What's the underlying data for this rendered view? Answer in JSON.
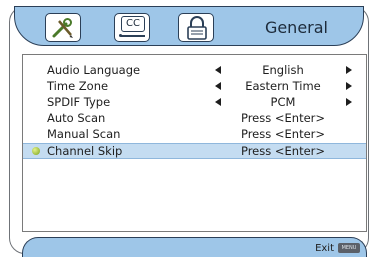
{
  "header": {
    "tabs": [
      {
        "icon": "wrench-pencil-icon"
      },
      {
        "label": "CC"
      },
      {
        "icon": "lock-icon"
      }
    ],
    "title": "General"
  },
  "menu": {
    "rows": [
      {
        "label": "Audio Language",
        "value": "English"
      },
      {
        "label": "Time Zone",
        "value": "Eastern Time"
      },
      {
        "label": "SPDIF Type",
        "value": "PCM"
      },
      {
        "label": "Auto Scan",
        "value": "Press <Enter>"
      },
      {
        "label": "Manual Scan",
        "value": "Press <Enter>"
      },
      {
        "label": "Channel Skip",
        "value": "Press <Enter>"
      }
    ]
  },
  "footer": {
    "exit_label": "Exit",
    "menu_key": "MENU"
  },
  "colors": {
    "accent": "#9ec6e8",
    "selected_row": "#c4dcf1",
    "border": "#2b3f57"
  }
}
